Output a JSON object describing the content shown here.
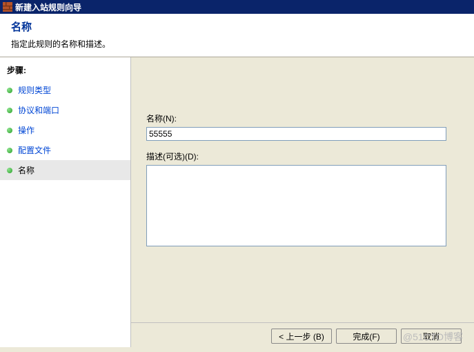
{
  "titlebar": {
    "icon_name": "firewall-icon",
    "text": "新建入站规则向导"
  },
  "header": {
    "title": "名称",
    "description": "指定此规则的名称和描述。"
  },
  "sidebar": {
    "heading": "步骤:",
    "items": [
      {
        "label": "规则类型",
        "state": "done"
      },
      {
        "label": "协议和端口",
        "state": "done"
      },
      {
        "label": "操作",
        "state": "done"
      },
      {
        "label": "配置文件",
        "state": "done"
      },
      {
        "label": "名称",
        "state": "current"
      }
    ]
  },
  "content": {
    "name_label": "名称(N):",
    "name_value": "55555",
    "desc_label": "描述(可选)(D):",
    "desc_value": ""
  },
  "footer": {
    "back": "< 上一步 (B)",
    "finish": "完成(F)",
    "cancel": "取消"
  },
  "watermark": "@51CTO博客"
}
